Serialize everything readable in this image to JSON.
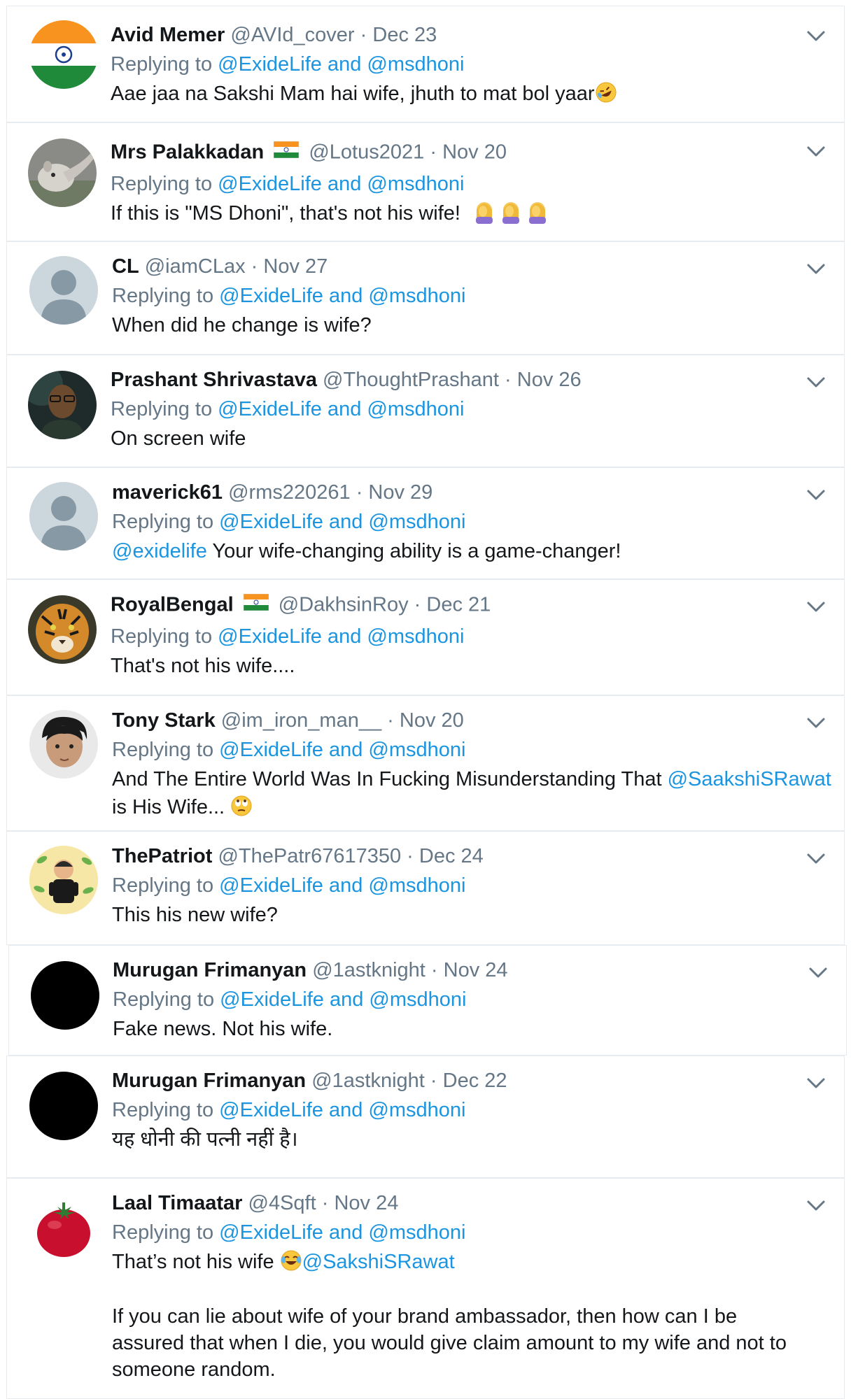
{
  "reply_prefix": "Replying to",
  "reply_and": "and",
  "tweets": [
    {
      "name": "Avid Memer",
      "handle": "@AVId_cover",
      "sep": "·",
      "date": "Dec 23",
      "mentions": [
        "@ExideLife",
        "@msdhoni"
      ],
      "text": "Aae jaa na Sakshi Mam hai wife, jhuth to mat bol yaar",
      "avatar": "india-flag-avatar",
      "emoji": "rolling-laughing-emoji"
    },
    {
      "name": "Mrs Palakkadan",
      "handle": "@Lotus2021",
      "sep": "·",
      "date": "Nov 20",
      "mentions": [
        "@ExideLife",
        "@msdhoni"
      ],
      "text": "If this is \"MS Dhoni\", that's not his wife!",
      "avatar": "anteater-avatar",
      "emoji": "facepalm-emoji"
    },
    {
      "name": "CL",
      "handle": "@iamCLax",
      "sep": "·",
      "date": "Nov 27",
      "mentions": [
        "@ExideLife",
        "@msdhoni"
      ],
      "text": "When did he change is wife?",
      "avatar": "default-avatar"
    },
    {
      "name": "Prashant Shrivastava",
      "handle": "@ThoughtPrashant",
      "sep": "·",
      "date": "Nov 26",
      "mentions": [
        "@ExideLife",
        "@msdhoni"
      ],
      "text": "On screen wife",
      "avatar": "portrait-avatar"
    },
    {
      "name": "maverick61",
      "handle": "@rms220261",
      "sep": "·",
      "date": "Nov 29",
      "mentions": [
        "@ExideLife",
        "@msdhoni"
      ],
      "text_mention": "@exidelife",
      "text": "Your wife-changing ability is a game-changer!",
      "avatar": "default-avatar"
    },
    {
      "name": "RoyalBengal",
      "handle": "@DakhsinRoy",
      "sep": "·",
      "date": "Dec 21",
      "mentions": [
        "@ExideLife",
        "@msdhoni"
      ],
      "text": "That's not his wife....",
      "avatar": "tiger-avatar"
    },
    {
      "name": "Tony Stark",
      "handle": "@im_iron_man__",
      "sep": "·",
      "date": "Nov 20",
      "mentions": [
        "@ExideLife",
        "@msdhoni"
      ],
      "text": "And The Entire World Was In Fucking Misunderstanding That",
      "text_link": "@SaakshiSRawat",
      "text_line2": "is His Wife...",
      "avatar": "selfie-avatar",
      "emoji": "eye-roll-emoji"
    },
    {
      "name": "ThePatriot",
      "handle": "@ThePatr67617350",
      "sep": "·",
      "date": "Dec 24",
      "mentions": [
        "@ExideLife",
        "@msdhoni"
      ],
      "text": "This his new wife?",
      "avatar": "cartoon-avatar"
    },
    {
      "name": "Murugan Frimanyan",
      "handle": "@1astknight",
      "sep": "·",
      "date": "Nov 24",
      "mentions": [
        "@ExideLife",
        "@msdhoni"
      ],
      "text": "Fake news. Not his wife.",
      "avatar": "black-avatar"
    },
    {
      "name": "Murugan Frimanyan",
      "handle": "@1astknight",
      "sep": "·",
      "date": "Dec 22",
      "mentions": [
        "@ExideLife",
        "@msdhoni"
      ],
      "text": "यह धोनी की पत्नी नहीं है।",
      "avatar": "black-avatar"
    },
    {
      "name": "Laal Timaatar",
      "handle": "@4Sqft",
      "sep": "·",
      "date": "Nov 24",
      "mentions": [
        "@ExideLife",
        "@msdhoni"
      ],
      "text": "That’s not his wife",
      "text_link": "@SakshiSRawat",
      "text_para": "If you can lie about wife of your brand ambassador, then how can I be assured that when I die, you would give claim amount to my wife and not to someone random.",
      "avatar": "tomato-avatar",
      "emoji": "tears-joy-emoji"
    }
  ]
}
